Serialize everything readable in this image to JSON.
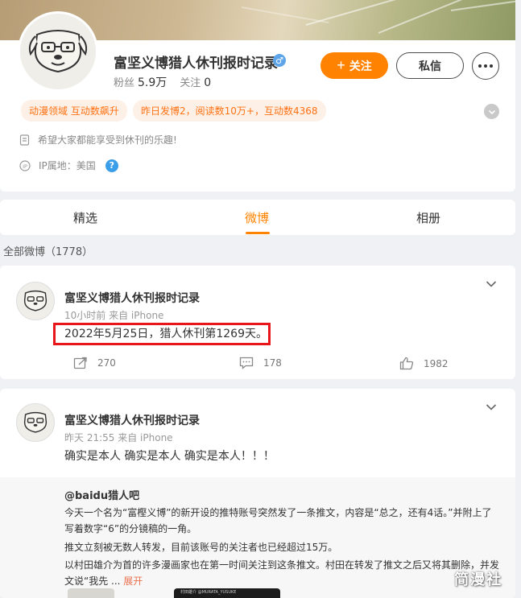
{
  "profile": {
    "name": "富坚义博猎人休刊报时记录",
    "fans_label": "粉丝",
    "fans_count": "5.9万",
    "following_label": "关注",
    "following_count": "0",
    "follow_button": "关注",
    "message_button": "私信",
    "tags": [
      "动漫领域 互动数飙升",
      "昨日发博2，阅读数10万+，互动数4368"
    ],
    "bio": "希望大家都能享受到休刊的乐趣!",
    "ip_location": "IP属地：美国"
  },
  "tabs": [
    {
      "label": "精选",
      "active": false
    },
    {
      "label": "微博",
      "active": true
    },
    {
      "label": "相册",
      "active": false
    }
  ],
  "all_weibo_label": "全部微博（1778）",
  "posts": [
    {
      "author": "富坚义博猎人休刊报时记录",
      "time": "10小时前",
      "source": "来自 iPhone",
      "text": "2022年5月25日，猎人休刊第1269天。",
      "reposts": "270",
      "comments": "178",
      "likes": "1982"
    },
    {
      "author": "富坚义博猎人休刊报时记录",
      "time": "昨天 21:55",
      "source": "来自 iPhone",
      "text": "确实是本人 确实是本人 确实是本人！！！",
      "retweet": {
        "user": "@baidu猎人吧",
        "lines": [
          "今天一个名为“富樫义博”的新开设的推特账号突然发了一条推文，内容是“总之，还有4话。”并附上了",
          "写着数字“6”的分镜稿的一角。",
          "推文立刻被无数人转发，目前该账号的关注者也已经超过15万。",
          "以村田雄介为首的许多漫画家也在第一时间关注到这条推文。村田在转发了推文之后又将其删除，并发",
          "文说“我先"
        ],
        "ellipsis": " ... ",
        "expand_label": "展开",
        "thumb_caption": "村田雄介 @MURATA_YUSUKE"
      }
    }
  ],
  "watermark": "简漫社",
  "colors": {
    "accent_orange": "#ff8200",
    "highlight_red": "#e8151b",
    "verified_blue": "#5da5e8",
    "link_orange": "#eb7350"
  },
  "icons": {
    "gender": "male-icon",
    "bio": "document-icon",
    "ip": "ip-location-icon",
    "help": "question-icon",
    "repost": "repost-icon",
    "comment": "comment-icon",
    "like": "thumbs-up-icon",
    "expand": "chevron-down-icon"
  }
}
